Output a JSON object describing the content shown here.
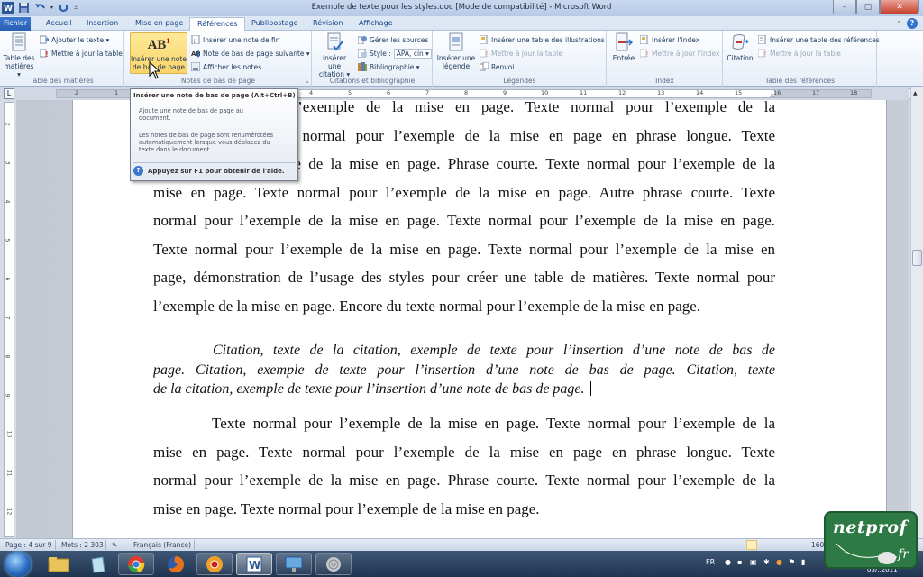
{
  "window": {
    "title": "Exemple de texte pour les styles.doc [Mode de compatibilité]  -  Microsoft Word",
    "controls": {
      "minimize": "–",
      "maximize": "▢",
      "close": "✕"
    }
  },
  "quick_access": {
    "icons": [
      "word-logo-icon",
      "save-icon",
      "undo-icon",
      "redo-icon",
      "customize-icon"
    ]
  },
  "tabs": [
    {
      "label": "Fichier"
    },
    {
      "label": "Accueil"
    },
    {
      "label": "Insertion"
    },
    {
      "label": "Mise en page"
    },
    {
      "label": "Références",
      "active": true
    },
    {
      "label": "Publipostage"
    },
    {
      "label": "Révision"
    },
    {
      "label": "Affichage"
    }
  ],
  "ribbon": {
    "groups": {
      "toc": {
        "label": "Table des matières",
        "big_button": "Table des\nmatières ▾",
        "big_line1": "Table des",
        "big_line2": "matières ▾",
        "add_text": "Ajouter le texte ▾",
        "update_table": "Mettre à jour la table"
      },
      "footnotes": {
        "label": "Notes de bas de page",
        "big_glyph": "AB",
        "big_sup": "1",
        "big_line1": "Insérer une note",
        "big_line2": "de bas de page",
        "insert_endnote": "Insérer une note de fin",
        "next_footnote": "Note de bas de page suivante ▾",
        "show_notes": "Afficher les notes"
      },
      "citations": {
        "label": "Citations et bibliographie",
        "big_line1": "Insérer une",
        "big_line2": "citation ▾",
        "manage_sources": "Gérer les sources",
        "style_label": "Style :",
        "style_value": "APA, cin ▾",
        "bibliography": "Bibliographie ▾"
      },
      "captions": {
        "label": "Légendes",
        "big_line1": "Insérer une",
        "big_line2": "légende",
        "insert_tof": "Insérer une table des illustrations",
        "update_table": "Mettre à jour la table",
        "cross_ref": "Renvoi"
      },
      "index": {
        "label": "Index",
        "big_label": "Entrée",
        "insert_index": "Insérer l'index",
        "update_index": "Mettre à jour l'index"
      },
      "toa": {
        "label": "Table des références",
        "big_label": "Citation",
        "insert_toa": "Insérer une table des références",
        "update_table": "Mettre à jour la table"
      }
    }
  },
  "ruler": {
    "tab_selector": "L",
    "numbers_left": [
      "2",
      "1"
    ],
    "numbers_right": [
      "1",
      "2",
      "3",
      "4",
      "5",
      "6",
      "7",
      "8",
      "9",
      "10",
      "11",
      "12",
      "13",
      "14",
      "15",
      "16",
      "17",
      "18"
    ],
    "vertical_numbers": [
      "2",
      "3",
      "4",
      "5",
      "6",
      "7",
      "8",
      "9",
      "10",
      "11",
      "12"
    ]
  },
  "tooltip": {
    "title": "Insérer une note de bas de page (Alt+Ctrl+B)",
    "body1": [
      "Ajoute une note de bas de page au",
      "document."
    ],
    "body2": [
      "Les notes de bas de page sont renumérotées",
      "automatiquement lorsque vous déplacez du",
      "texte dans le document."
    ],
    "help": "Appuyez sur F1 pour obtenir de l'aide."
  },
  "document": {
    "para1": [
      "Texte normal pour l’exemple de la mise en page. Texte normal pour l’exemple de la",
      "mise en page. Texte normal pour l’exemple de la mise en page en phrase longue. Texte",
      "normal pour l’exemple de la mise en page.  Phrase courte. Texte normal pour l’exemple de la",
      "mise en page. Texte normal pour l’exemple de la mise en page. Autre phrase courte. Texte",
      "normal pour l’exemple de la mise en page. Texte normal pour l’exemple de la mise en page.",
      "Texte normal pour l’exemple de la mise en page. Texte normal pour l’exemple de la mise en",
      "page, démonstration de l’usage des styles pour créer une table de matières. Texte normal pour",
      "l’exemple de la mise en page. Encore du texte normal pour l’exemple de la mise en page."
    ],
    "quote": [
      "Citation, texte de la citation, exemple de texte pour l’insertion d’une note de bas de",
      "page.  Citation, exemple de texte pour l’insertion d’une note de bas de page.  Citation, texte",
      "de la citation, exemple de texte pour l’insertion d’une note de bas de page."
    ],
    "para2": [
      "Texte normal pour l’exemple de la mise en page. Texte normal pour l’exemple de la",
      "mise en page. Texte normal pour l’exemple de la mise en page en phrase longue. Texte",
      "normal pour l’exemple de la mise en page.  Phrase courte. Texte normal pour l’exemple de la",
      "mise en page. Texte normal pour l’exemple de la mise en page."
    ]
  },
  "statusbar": {
    "page": "Page : 4 sur 9",
    "words": "Mots : 2 303",
    "language": "Français (France)",
    "zoom": "160"
  },
  "taskbar": {
    "language": "FR",
    "date": "05/..2011",
    "apps": [
      "windows-start",
      "explorer",
      "notepad",
      "chrome",
      "firefox",
      "chrome-canary",
      "word",
      "remote-desktop",
      "fingerprint"
    ]
  },
  "watermark": {
    "line1": "netprof",
    "line2": ".fr"
  },
  "colors": {
    "accent": "#2a5fb0",
    "highlight": "#fbd569",
    "watermark": "#2d7a45"
  }
}
